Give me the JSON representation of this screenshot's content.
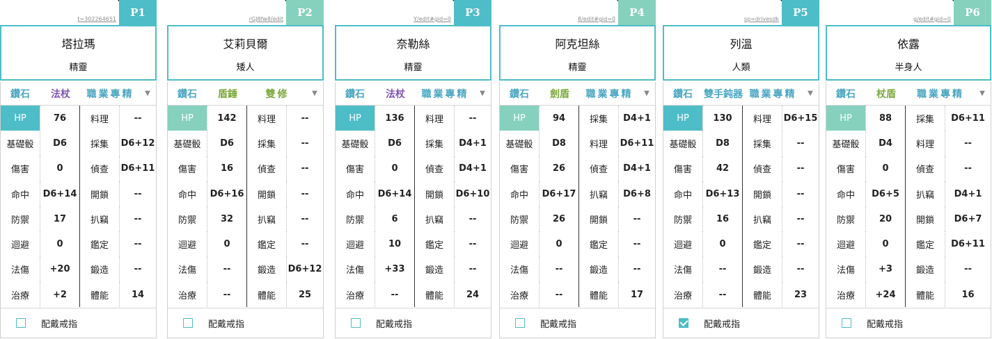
{
  "colors": {
    "header_border": "#4dbdc7",
    "teal": "#4dbdc7",
    "mint": "#85d1bd",
    "purple": "#7f55b0",
    "green": "#7aa83a",
    "blue": "#4aa6c2"
  },
  "cards": [
    {
      "tag": "P1",
      "url": "t=302264651",
      "tagColor": "#4dbdc7",
      "hpColor": "#4dbdc7",
      "name": "塔拉瑪",
      "race": "精靈",
      "gem": "鑽石",
      "weapon": "法杖",
      "weaponColor": "#7f55b0",
      "klass": "職業專精",
      "classColor": "#4aa6c2",
      "stats": [
        {
          "l": "HP",
          "v": "76",
          "s": "料理",
          "sv": "--"
        },
        {
          "l": "基礎骰",
          "v": "D6",
          "s": "採集",
          "sv": "D6+12"
        },
        {
          "l": "傷害",
          "v": "0",
          "s": "偵查",
          "sv": "D6+11"
        },
        {
          "l": "命中",
          "v": "D6+14",
          "s": "開鎖",
          "sv": "--"
        },
        {
          "l": "防禦",
          "v": "17",
          "s": "扒竊",
          "sv": "--"
        },
        {
          "l": "迴避",
          "v": "0",
          "s": "鑑定",
          "sv": "--"
        },
        {
          "l": "法傷",
          "v": "+20",
          "s": "鍛造",
          "sv": "--"
        },
        {
          "l": "治療",
          "v": "+2",
          "s": "體能",
          "sv": "14"
        }
      ],
      "ring": "配戴戒指",
      "ringChecked": false
    },
    {
      "tag": "P2",
      "url": "rGJ8fw8/edit",
      "tagColor": "#85d1bd",
      "hpColor": "#85d1bd",
      "name": "艾莉貝爾",
      "race": "矮人",
      "gem": "鑽石",
      "weapon": "盾錘",
      "weaponColor": "#7aa83a",
      "klass": "雙修",
      "classColor": "#7aa83a",
      "stats": [
        {
          "l": "HP",
          "v": "142",
          "s": "料理",
          "sv": "--"
        },
        {
          "l": "基礎骰",
          "v": "D6",
          "s": "採集",
          "sv": "--"
        },
        {
          "l": "傷害",
          "v": "16",
          "s": "偵查",
          "sv": "--"
        },
        {
          "l": "命中",
          "v": "D6+16",
          "s": "開鎖",
          "sv": "--"
        },
        {
          "l": "防禦",
          "v": "32",
          "s": "扒竊",
          "sv": "--"
        },
        {
          "l": "迴避",
          "v": "0",
          "s": "鑑定",
          "sv": "--"
        },
        {
          "l": "法傷",
          "v": "--",
          "s": "鍛造",
          "sv": "D6+12"
        },
        {
          "l": "治療",
          "v": "--",
          "s": "體能",
          "sv": "25"
        }
      ],
      "ring": "配戴戒指",
      "ringChecked": false
    },
    {
      "tag": "P3",
      "url": "Y/edit#gid=0",
      "tagColor": "#4dbdc7",
      "hpColor": "#4dbdc7",
      "name": "奈勒絲",
      "race": "精靈",
      "gem": "鑽石",
      "weapon": "法杖",
      "weaponColor": "#7f55b0",
      "klass": "職業專精",
      "classColor": "#4aa6c2",
      "stats": [
        {
          "l": "HP",
          "v": "136",
          "s": "料理",
          "sv": "--"
        },
        {
          "l": "基礎骰",
          "v": "D6",
          "s": "採集",
          "sv": "D4+1"
        },
        {
          "l": "傷害",
          "v": "0",
          "s": "偵查",
          "sv": "D4+1"
        },
        {
          "l": "命中",
          "v": "D6+14",
          "s": "開鎖",
          "sv": "D6+10"
        },
        {
          "l": "防禦",
          "v": "6",
          "s": "扒竊",
          "sv": "--"
        },
        {
          "l": "迴避",
          "v": "10",
          "s": "鑑定",
          "sv": "--"
        },
        {
          "l": "法傷",
          "v": "+33",
          "s": "鍛造",
          "sv": "--"
        },
        {
          "l": "治療",
          "v": "--",
          "s": "體能",
          "sv": "24"
        }
      ],
      "ring": "配戴戒指",
      "ringChecked": false
    },
    {
      "tag": "P4",
      "url": "8/edit#gid=0",
      "tagColor": "#85d1bd",
      "hpColor": "#85d1bd",
      "name": "阿克坦絲",
      "race": "精靈",
      "gem": "鑽石",
      "weapon": "劍盾",
      "weaponColor": "#7aa83a",
      "klass": "職業專精",
      "classColor": "#4aa6c2",
      "stats": [
        {
          "l": "HP",
          "v": "94",
          "s": "採集",
          "sv": "D4+1"
        },
        {
          "l": "基礎骰",
          "v": "D8",
          "s": "料理",
          "sv": "D6+11"
        },
        {
          "l": "傷害",
          "v": "26",
          "s": "偵查",
          "sv": "D4+1"
        },
        {
          "l": "命中",
          "v": "D6+17",
          "s": "扒竊",
          "sv": "D6+8"
        },
        {
          "l": "防禦",
          "v": "26",
          "s": "開鎖",
          "sv": "--"
        },
        {
          "l": "迴避",
          "v": "0",
          "s": "鑑定",
          "sv": "--"
        },
        {
          "l": "法傷",
          "v": "--",
          "s": "鍛造",
          "sv": "--"
        },
        {
          "l": "治療",
          "v": "--",
          "s": "體能",
          "sv": "17"
        }
      ],
      "ring": "配戴戒指",
      "ringChecked": false
    },
    {
      "tag": "P5",
      "url": "sp=drivesdk",
      "tagColor": "#4dbdc7",
      "hpColor": "#4dbdc7",
      "name": "列溫",
      "race": "人類",
      "gem": "鑽石",
      "weapon": "雙手鈍器",
      "weaponColor": "#4aa6c2",
      "klass": "職業專精",
      "classColor": "#4aa6c2",
      "stats": [
        {
          "l": "HP",
          "v": "130",
          "s": "料理",
          "sv": "D6+15"
        },
        {
          "l": "基礎骰",
          "v": "D8",
          "s": "採集",
          "sv": "--"
        },
        {
          "l": "傷害",
          "v": "42",
          "s": "偵查",
          "sv": "--"
        },
        {
          "l": "命中",
          "v": "D6+13",
          "s": "開鎖",
          "sv": "--"
        },
        {
          "l": "防禦",
          "v": "16",
          "s": "扒竊",
          "sv": "--"
        },
        {
          "l": "迴避",
          "v": "0",
          "s": "鑑定",
          "sv": "--"
        },
        {
          "l": "法傷",
          "v": "--",
          "s": "鍛造",
          "sv": "--"
        },
        {
          "l": "治療",
          "v": "--",
          "s": "體能",
          "sv": "23"
        }
      ],
      "ring": "配戴戒指",
      "ringChecked": true
    },
    {
      "tag": "P6",
      "url": "g/edit#gid=0",
      "tagColor": "#85d1bd",
      "hpColor": "#85d1bd",
      "name": "依露",
      "race": "半身人",
      "gem": "鑽石",
      "weapon": "杖盾",
      "weaponColor": "#7aa83a",
      "klass": "職業專精",
      "classColor": "#4aa6c2",
      "stats": [
        {
          "l": "HP",
          "v": "88",
          "s": "採集",
          "sv": "D6+11"
        },
        {
          "l": "基礎骰",
          "v": "D4",
          "s": "料理",
          "sv": "--"
        },
        {
          "l": "傷害",
          "v": "0",
          "s": "偵查",
          "sv": "--"
        },
        {
          "l": "命中",
          "v": "D6+5",
          "s": "扒竊",
          "sv": "D4+1"
        },
        {
          "l": "防禦",
          "v": "20",
          "s": "開鎖",
          "sv": "D6+7"
        },
        {
          "l": "迴避",
          "v": "0",
          "s": "鑑定",
          "sv": "D6+11"
        },
        {
          "l": "法傷",
          "v": "+3",
          "s": "鍛造",
          "sv": "--"
        },
        {
          "l": "治療",
          "v": "+24",
          "s": "體能",
          "sv": "16"
        }
      ],
      "ring": "配戴戒指",
      "ringChecked": false
    }
  ]
}
